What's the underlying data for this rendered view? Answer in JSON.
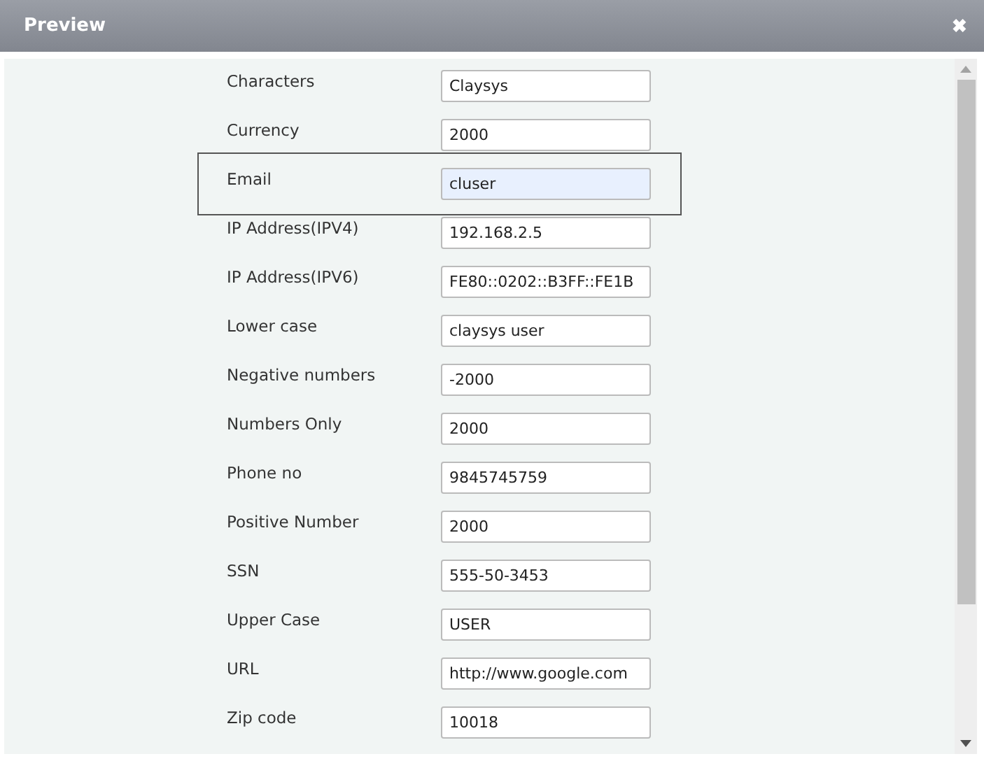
{
  "window": {
    "title": "Preview",
    "close": "✖"
  },
  "fields": [
    {
      "label": "Characters",
      "value": "Claysys",
      "selected": false
    },
    {
      "label": "Currency",
      "value": "2000",
      "selected": false
    },
    {
      "label": "Email",
      "value": "cluser",
      "selected": true
    },
    {
      "label": "IP Address(IPV4)",
      "value": "192.168.2.5",
      "selected": false
    },
    {
      "label": "IP Address(IPV6)",
      "value": "FE80::0202::B3FF::FE1B",
      "selected": false
    },
    {
      "label": "Lower case",
      "value": "claysys user",
      "selected": false
    },
    {
      "label": "Negative numbers",
      "value": "-2000",
      "selected": false
    },
    {
      "label": "Numbers Only",
      "value": "2000",
      "selected": false
    },
    {
      "label": "Phone no",
      "value": "9845745759",
      "selected": false
    },
    {
      "label": "Positive Number",
      "value": "2000",
      "selected": false
    },
    {
      "label": "SSN",
      "value": "555-50-3453",
      "selected": false
    },
    {
      "label": "Upper Case",
      "value": "USER",
      "selected": false
    },
    {
      "label": "URL",
      "value": "http://www.google.com",
      "selected": false
    },
    {
      "label": "Zip code",
      "value": "10018",
      "selected": false
    }
  ]
}
